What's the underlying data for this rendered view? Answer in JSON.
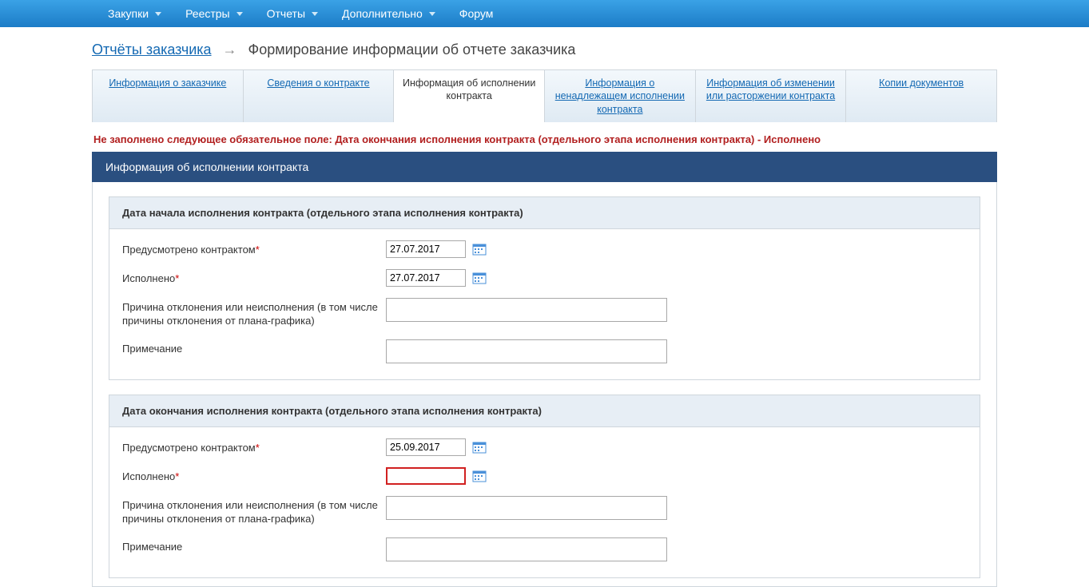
{
  "nav": {
    "items": [
      "Закупки",
      "Реестры",
      "Отчеты",
      "Дополнительно"
    ],
    "forum": "Форум"
  },
  "breadcrumb": {
    "root": "Отчёты заказчика",
    "current": "Формирование информации об отчете заказчика"
  },
  "tabs": [
    {
      "label": "Информация о заказчике"
    },
    {
      "label": "Сведения о контракте"
    },
    {
      "label": "Информация об исполнении контракта"
    },
    {
      "label": "Информация о ненадлежащем исполнении контракта"
    },
    {
      "label": "Информация об изменении или расторжении контракта"
    },
    {
      "label": "Копии документов"
    }
  ],
  "error_text": "Не заполнено следующее обязательное поле: Дата окончания исполнения контракта (отдельного этапа исполнения контракта) - Исполнено",
  "panel_title": "Информация об исполнении контракта",
  "sections": {
    "start": {
      "title": "Дата начала исполнения контракта (отдельного этапа исполнения контракта)",
      "rows": {
        "planned": {
          "label": "Предусмотрено контрактом",
          "value": "27.07.2017"
        },
        "done": {
          "label": "Исполнено",
          "value": "27.07.2017"
        },
        "reason": {
          "label": "Причина отклонения или неисполнения (в том числе причины отклонения от плана-графика)",
          "value": ""
        },
        "note": {
          "label": "Примечание",
          "value": ""
        }
      }
    },
    "end": {
      "title": "Дата окончания исполнения контракта (отдельного этапа исполнения контракта)",
      "rows": {
        "planned": {
          "label": "Предусмотрено контрактом",
          "value": "25.09.2017"
        },
        "done": {
          "label": "Исполнено",
          "value": ""
        },
        "reason": {
          "label": "Причина отклонения или неисполнения (в том числе причины отклонения от плана-графика)",
          "value": ""
        },
        "note": {
          "label": "Примечание",
          "value": ""
        }
      }
    }
  }
}
